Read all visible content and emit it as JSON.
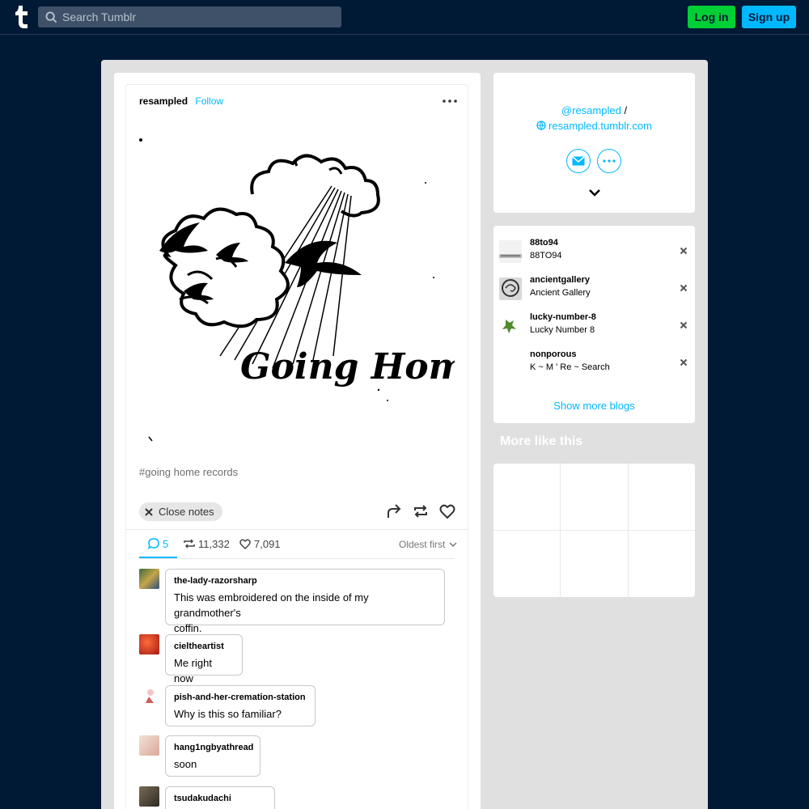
{
  "header": {
    "search_placeholder": "Search Tumblr",
    "login_label": "Log in",
    "signup_label": "Sign up"
  },
  "post": {
    "author": "resampled",
    "follow_label": "Follow",
    "image_caption": "Going Home...",
    "tag": "#going home records",
    "close_notes_label": "Close notes"
  },
  "notes": {
    "replies_count": "5",
    "reblogs_count": "11,332",
    "likes_count": "7,091",
    "sort_label": "Oldest first",
    "replies": [
      {
        "name": "the-lady-razorsharp",
        "text": "This was embroidered on the inside of my grandmother's coffin.",
        "text_line1": "This was embroidered on the inside of my grandmother's",
        "text_line2": "coffin."
      },
      {
        "name": "cieltheartist",
        "text": "Me right now"
      },
      {
        "name": "pish-and-her-cremation-station",
        "text": "Why is this so familiar?"
      },
      {
        "name": "hang1ngbyathread",
        "text": "soon"
      },
      {
        "name": "tsudakudachi",
        "text": ""
      }
    ]
  },
  "sidebar": {
    "blog_handle": "@resampled",
    "slash": "/",
    "blog_url": "resampled.tumblr.com",
    "recommended_blogs": [
      {
        "name": "88to94",
        "title": "88TO94"
      },
      {
        "name": "ancientgallery",
        "title": "Ancient Gallery"
      },
      {
        "name": "lucky-number-8",
        "title": "Lucky Number 8"
      },
      {
        "name": "nonporous",
        "title": "K ~ M ' Re ~ Search"
      }
    ],
    "show_more_label": "Show more blogs",
    "more_like_title": "More like this"
  },
  "colors": {
    "background": "#001935",
    "accent": "#00b8ff",
    "login": "#00cf35"
  }
}
